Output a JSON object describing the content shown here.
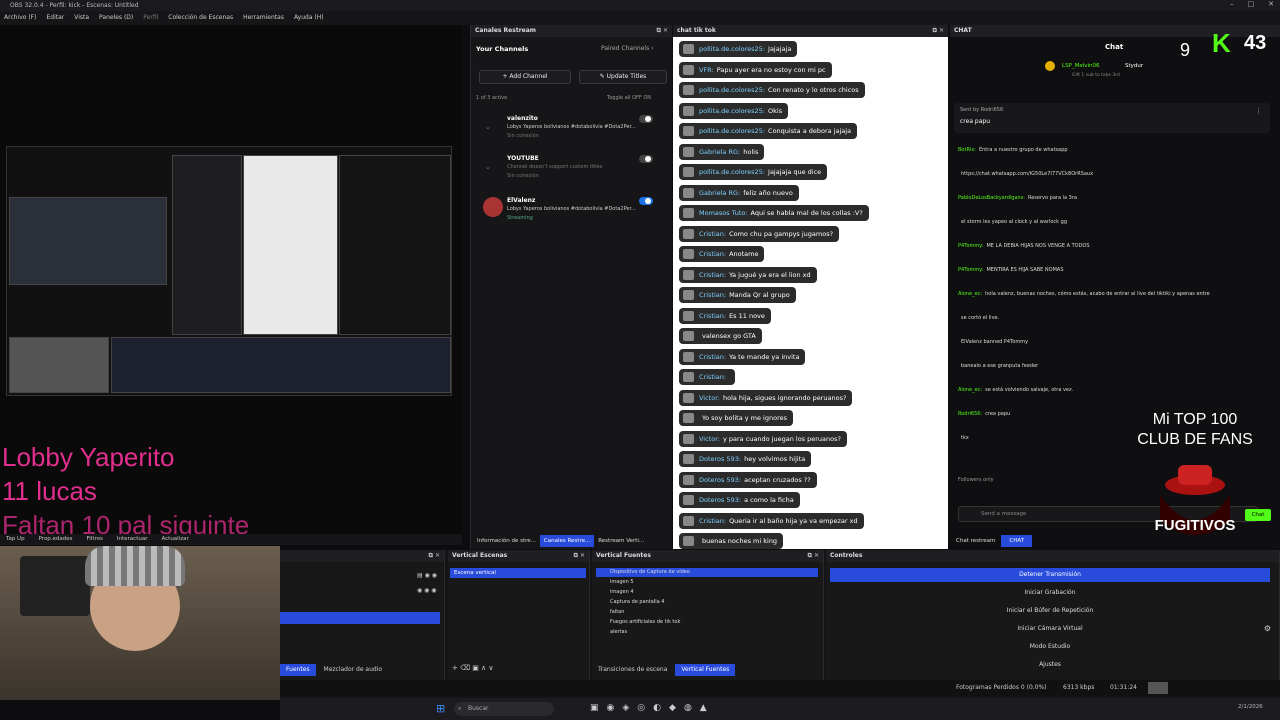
{
  "window": {
    "title": "OBS 32.0.4 - Perfil: kick - Escenas: Untitled"
  },
  "menu": [
    "Archivo (F)",
    "Editar",
    "Vista",
    "Paneles (D)",
    "Perfil",
    "Colección de Escenas",
    "Herramientas",
    "Ayuda (H)"
  ],
  "overlay": {
    "line1": "Lobby Yaperito",
    "line2": "11 lucas",
    "line3": "Faltan 10 pal siguinte"
  },
  "restream": {
    "title": "Canales Restream",
    "your_channels": "Your Channels",
    "paired": "Paired Channels",
    "add_channel": "Add Channel",
    "update_titles": "Update Titles",
    "active": "1 of 3 active",
    "toggle_all": "Toggle all OFF  ON",
    "channels": [
      {
        "name": "valenzito",
        "sub": "Lobys Yaperos bolivianos #dotabolivia #Dota2Per...",
        "status": "Sin conexión",
        "on": false
      },
      {
        "name": "YOUTUBE",
        "sub": "Channel doesn't support custom titles",
        "status": "Sin conexión",
        "on": false
      },
      {
        "name": "ElValenz",
        "sub": "Lobys Yaperos bolivianos #dotabolivia #Dota2Per...",
        "status": "Streaming",
        "on": true
      }
    ],
    "tabs": [
      "Información de stre...",
      "Canales Restre...",
      "Restream Verti..."
    ]
  },
  "tiktok": {
    "title": "chat tik tok",
    "messages": [
      {
        "user": "pollita.de.colores25:",
        "text": "Jajajaja"
      },
      {
        "user": "VFR:",
        "text": "Papu ayer era no estoy con mi pc"
      },
      {
        "user": "pollita.de.colores25:",
        "text": "Con renato y lo otros chicos"
      },
      {
        "user": "pollita.de.colores25:",
        "text": "Okis"
      },
      {
        "user": "pollita.de.colores25:",
        "text": "Conquista a debora jajaja"
      },
      {
        "user": "Gabriela RG:",
        "text": "holis"
      },
      {
        "user": "pollita.de.colores25:",
        "text": "Jajajaja que dice"
      },
      {
        "user": "Gabriela RG:",
        "text": "feliz año nuevo"
      },
      {
        "user": "Momasos Tuto:",
        "text": "Aqui se habla mal de los collas :V?"
      },
      {
        "user": "Cristian:",
        "text": "Como chu pa gampys jugamos?"
      },
      {
        "user": "Cristian:",
        "text": "Anotame"
      },
      {
        "user": "Cristian:",
        "text": "Ya jugué ya era el lion xd"
      },
      {
        "user": "Cristian:",
        "text": "Manda Qr al grupo"
      },
      {
        "user": "Cristian:",
        "text": "Es 11 nove"
      },
      {
        "user": "",
        "text": "valensex go GTA"
      },
      {
        "user": "Cristian:",
        "text": "Ya te mande ya invita"
      },
      {
        "user": "Cristian:",
        "text": ""
      },
      {
        "user": "Victor:",
        "text": "hola hija, sigues ignorando peruanos?"
      },
      {
        "user": "",
        "text": "Yo soy bolita y me ignores"
      },
      {
        "user": "Victor:",
        "text": "y para cuando juegan los peruanos?"
      },
      {
        "user": "Doteros 593:",
        "text": "hey volvimos hijita"
      },
      {
        "user": "Doteros 593:",
        "text": "aceptan cruzados ??"
      },
      {
        "user": "Doteros 593:",
        "text": "a como la ficha"
      },
      {
        "user": "Cristian:",
        "text": "Queria ir al baño hija ya va empezar xd"
      },
      {
        "user": "",
        "text": "buenas noches mi king"
      }
    ]
  },
  "chat": {
    "title": "CHAT",
    "header": "Chat",
    "pinned_user": "LSP_Melvin06",
    "pinned_gift": "Stydur",
    "gift_text": "Gift 1 sub to take 3rd",
    "sent_by": "Sent by Rodri656",
    "pinned_msg": "crea papu",
    "lines": [
      {
        "u": "BotRix:",
        "t": "Entra a nuestro grupo de whatsapp"
      },
      {
        "u": "",
        "t": "https://chat.whatsapp.com/IG50Le7I77VCk8OrRSaux"
      },
      {
        "u": "PabloDeLosBackyardigans:",
        "t": "Reservo para la 3ra"
      },
      {
        "u": "",
        "t": "el storm les yapeo al clock y al warlock gg"
      },
      {
        "u": "P4Tommy:",
        "t": "ME LA DEBIA HIJAS NOS VENGE A TODOS"
      },
      {
        "u": "P4Tommy:",
        "t": "MENTIRA ES HIJA SABE NOMAS"
      },
      {
        "u": "Aione_ec:",
        "t": "hola valenz, buenas noches, cómo estás, acabo de entrar al live del tiktiki y apenas entre"
      },
      {
        "u": "",
        "t": "se cortó el live."
      },
      {
        "u": "",
        "t": "ElValenz banned P4Tommy"
      },
      {
        "u": "",
        "t": "banealo a ese granputa feeder"
      },
      {
        "u": "Aione_ec:",
        "t": "se está volviendo salvaje, otra vez."
      },
      {
        "u": "Rodri656:",
        "t": "crea papu"
      },
      {
        "u": "",
        "t": "tkx"
      }
    ],
    "followers_only": "Followers only",
    "send_placeholder": "Send a message",
    "send_btn": "Chat",
    "tabs": [
      "Chat restream",
      "CHAT"
    ]
  },
  "kick": {
    "count": "43",
    "viewers": "9"
  },
  "fans": {
    "line1": "Mi TOP 100",
    "line2": "CLUB DE FANS",
    "logo": "FUGITIVOS"
  },
  "preview_toolbar": {
    "tab_up": "Tap Up",
    "props": "Prop.edades",
    "filters": "Filtros",
    "interact": "Interactuar",
    "refresh": "Actualizar"
  },
  "dock": {
    "scenes_title": "Vertical Escenas",
    "scene_active": "Escena vertical",
    "sources_title": "Vertical Fuentes",
    "sources": [
      "Dispositivo de Captura de vídeo",
      "imagen 5",
      "imagen 4",
      "Captura de pantalla 4",
      "faltan",
      "Fuegos artificiales de tik tok",
      "alertas"
    ],
    "left_tabs": [
      "Fuentes",
      "Mezclador de audio"
    ],
    "mid_tabs": [
      "Transiciones de escena",
      "Vertical Fuentes"
    ],
    "controls_title": "Controles",
    "controls": [
      "Detener Transmisión",
      "Iniciar Grabación",
      "Iniciar el Búfer de Repetición",
      "Iniciar Cámara Virtual",
      "Modo Estudio",
      "Ajustes"
    ]
  },
  "status": {
    "dropped": "Fotogramas Perdidos 0 (0.0%)",
    "kbps": "6313 kbps",
    "time": "01:31:24"
  },
  "taskbar": {
    "search": "Buscar",
    "date": "2/1/2026"
  },
  "colors": {
    "accent": "#284bdc",
    "overlay_pink": "#e22f8e",
    "kick_green": "#53fc18"
  }
}
